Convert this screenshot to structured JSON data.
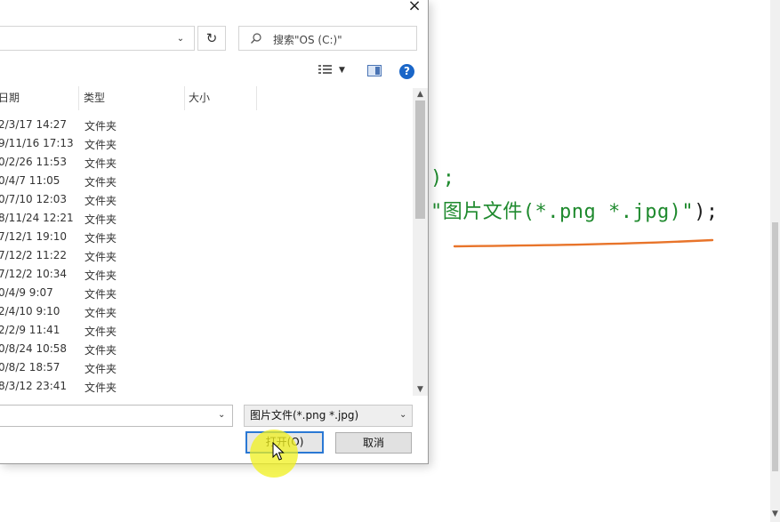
{
  "editor": {
    "line1": {
      "prefix": ");",
      "string": ""
    },
    "line2": {
      "string": "\"图片文件(*.png *.jpg)\"",
      "suffix": ");"
    }
  },
  "dialog": {
    "close_label": "×",
    "search_placeholder": "搜索\"OS (C:)\"",
    "columns": {
      "date": "日期",
      "type": "类型",
      "size": "大小"
    },
    "rows": [
      {
        "date": "2/3/17 14:27",
        "type": "文件夹"
      },
      {
        "date": "9/11/16 17:13",
        "type": "文件夹"
      },
      {
        "date": "0/2/26 11:53",
        "type": "文件夹"
      },
      {
        "date": "0/4/7 11:05",
        "type": "文件夹"
      },
      {
        "date": "0/7/10 12:03",
        "type": "文件夹"
      },
      {
        "date": "8/11/24 12:21",
        "type": "文件夹"
      },
      {
        "date": "7/12/1 19:10",
        "type": "文件夹"
      },
      {
        "date": "7/12/2 11:22",
        "type": "文件夹"
      },
      {
        "date": "7/12/2 10:34",
        "type": "文件夹"
      },
      {
        "date": "0/4/9 9:07",
        "type": "文件夹"
      },
      {
        "date": "2/4/10 9:10",
        "type": "文件夹"
      },
      {
        "date": "2/2/9 11:41",
        "type": "文件夹"
      },
      {
        "date": "0/8/24 10:58",
        "type": "文件夹"
      },
      {
        "date": "0/8/2 18:57",
        "type": "文件夹"
      },
      {
        "date": "8/3/12 23:41",
        "type": "文件夹"
      }
    ],
    "filter_value": "图片文件(*.png *.jpg)",
    "open_label": "打开(O)",
    "cancel_label": "取消"
  },
  "colors": {
    "string_green": "#1f8a2e",
    "annotation_orange": "#e8742a",
    "primary_button_border": "#2a78d4",
    "help_blue": "#1a66c8",
    "cursor_highlight": "#f0f01e"
  }
}
